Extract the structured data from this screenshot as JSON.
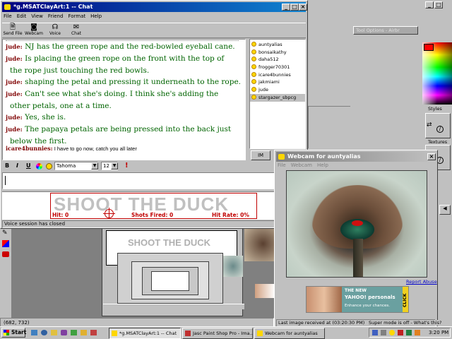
{
  "chat": {
    "title": "*g.MSATClayArt:1 -- Chat",
    "menu": [
      "File",
      "Edit",
      "View",
      "Friend",
      "Format",
      "Help"
    ],
    "toolbar": [
      "Send File",
      "Webcam",
      "Voice",
      "Chat"
    ],
    "messages": [
      {
        "user": "jude:",
        "text": "NJ has the green rope and the red-bowled eyeball cane."
      },
      {
        "user": "jude:",
        "text": "Is placing the green rope on the front with the top of"
      },
      {
        "user": "",
        "text": "the rope just touching the red bowls."
      },
      {
        "user": "jude:",
        "text": "shaping the petal and pressing it underneath to the rope."
      },
      {
        "user": "jude:",
        "text": "Can't see what she's doing. I think she's adding the"
      },
      {
        "user": "",
        "text": "other petals, one at a time."
      },
      {
        "user": "jude:",
        "text": "Yes, she is."
      },
      {
        "user": "jude:",
        "text": "The papaya petals are being pressed into the back just"
      },
      {
        "user": "",
        "text": "below the first."
      }
    ],
    "last_message": {
      "user": "icare4bunnies:",
      "text": "I have to go now, catch you all later"
    },
    "buddies": [
      "auntyalias",
      "bonsaikathy",
      "daha512",
      "frogger70301",
      "icare4bunnies",
      "jakmiami",
      "jude",
      "stargazer_sbpcg"
    ],
    "selected_buddy": "stargazer_sbpcg",
    "im_button": "IM",
    "format": {
      "bold": "B",
      "italic": "I",
      "underline": "U",
      "font": "Tahoma",
      "size": "12"
    },
    "ad": {
      "title": "SHOOT THE DUCK",
      "hits": "Hit: 0",
      "shots": "Shots Fired: 0",
      "rate": "Hit Rate: 0%"
    },
    "status": "Voice session has closed"
  },
  "webcam": {
    "title": "Webcam for auntyalias",
    "menu": [
      "File",
      "Webcam",
      "Help"
    ],
    "report_abuse": "Report Abuse",
    "ad_line1": "THE NEW",
    "ad_brand": "YAHOO! personals",
    "ad_line2": "Enhance your chances.",
    "ad_click": "CLICK",
    "status": "Last image received at (03:20:30 PM)"
  },
  "background": {
    "tool_options": "Tool Options - Airbr",
    "styles": "Styles",
    "textures": "Textures",
    "coords": "(682, 732)",
    "super_mode": "Super mode is off - What's this?"
  },
  "taskbar": {
    "start": "Start",
    "tasks": [
      "*g.MSATClayArt:1 -- Chat",
      "Jasc Paint Shop Pro - Ima...",
      "Webcam for auntyalias"
    ],
    "clock": "3:20 PM"
  },
  "colors": {
    "titlebar": "#000080",
    "chat_text": "#006400",
    "username": "#800000",
    "desktop": "#c0c0c0"
  }
}
